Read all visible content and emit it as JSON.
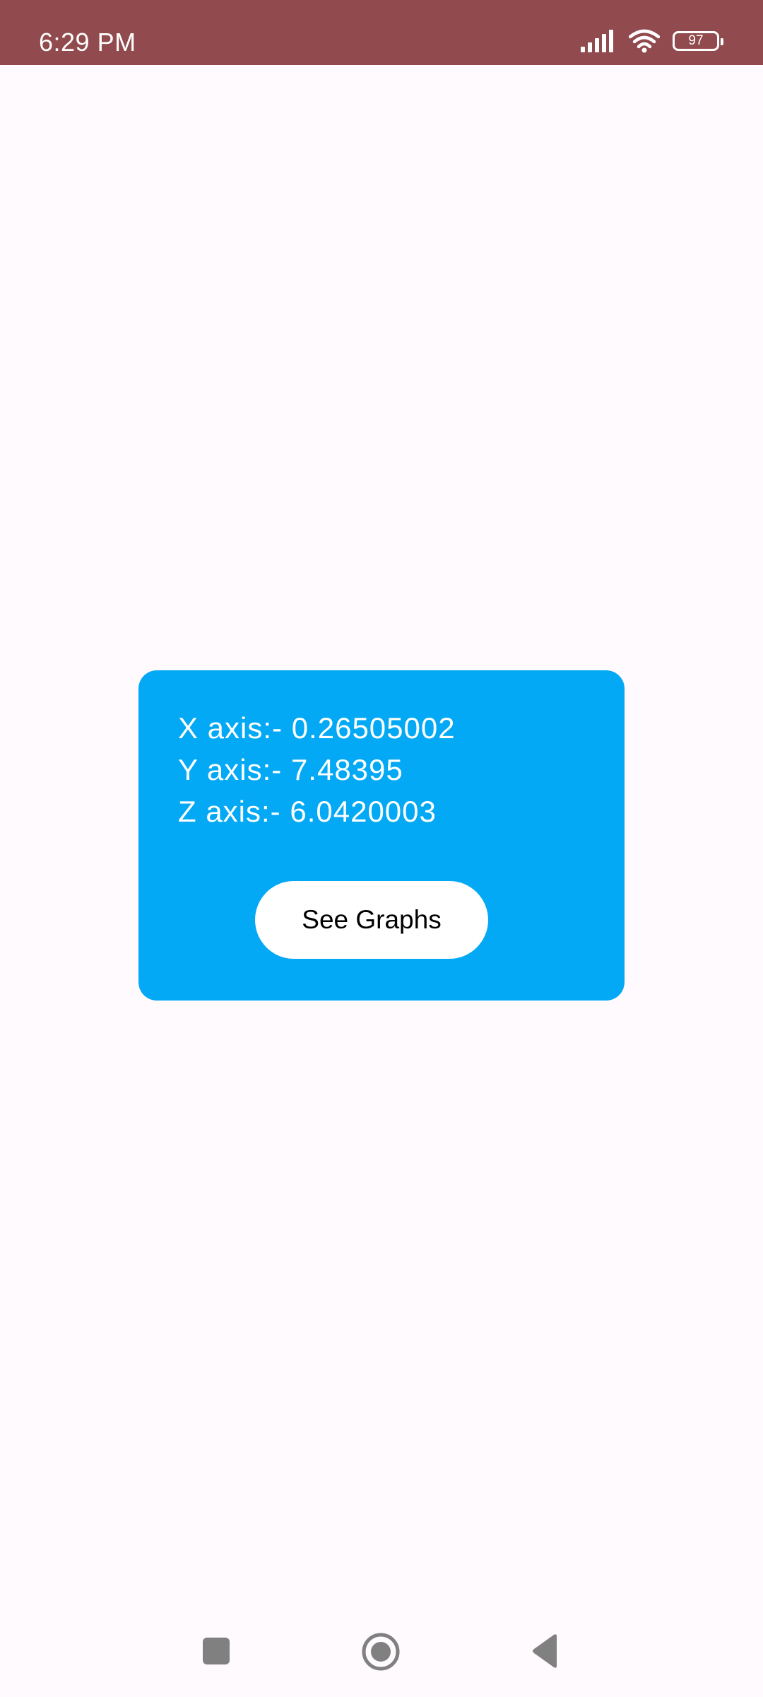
{
  "status_bar": {
    "time": "6:29 PM",
    "battery_level": "97",
    "icons": [
      "signal-icon",
      "wifi-icon",
      "battery-icon"
    ],
    "background_color": "#914A4D"
  },
  "sensor_card": {
    "background_color": "#03A9F4",
    "x_axis": "X axis:- 0.26505002",
    "y_axis": "Y axis:- 7.48395",
    "z_axis": "Z axis:- 6.0420003",
    "button_label": "See Graphs"
  },
  "nav_bar": {
    "icons": [
      "recents-icon",
      "home-icon",
      "back-icon"
    ]
  }
}
